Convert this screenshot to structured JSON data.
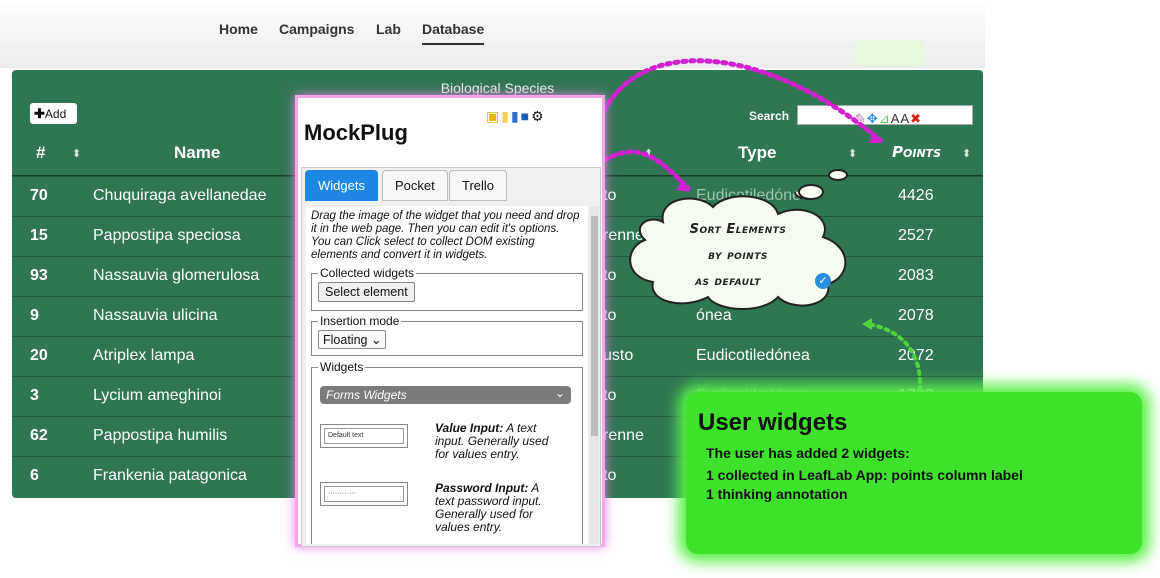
{
  "nav": {
    "items": [
      "Home",
      "Campaigns",
      "Lab",
      "Database"
    ],
    "active": "Database"
  },
  "table": {
    "title": "Biological Species",
    "add_label": "Add",
    "search_label": "Search",
    "headers": {
      "id": "#",
      "name": "Name",
      "type": "Type",
      "points": "Points"
    },
    "rows": [
      {
        "id": "70",
        "name": "Chuquiraga avellanedae",
        "loc": "to",
        "type": "Eudicotiledónea",
        "points": "4426"
      },
      {
        "id": "15",
        "name": "Pappostipa speciosa",
        "loc": "renne",
        "type": "",
        "points": "2527"
      },
      {
        "id": "93",
        "name": "Nassauvia glomerulosa",
        "loc": "to",
        "type": "",
        "points": "2083"
      },
      {
        "id": "9",
        "name": "Nassauvia ulicina",
        "loc": "to",
        "type": "ónea",
        "points": "2078"
      },
      {
        "id": "20",
        "name": "Atriplex lampa",
        "loc": "usto",
        "type": "Eudicotiledónea",
        "points": "2072"
      },
      {
        "id": "3",
        "name": "Lycium ameghinoi",
        "loc": "to",
        "type": "Eudicotiledónea",
        "points": "1732"
      },
      {
        "id": "62",
        "name": "Pappostipa humilis",
        "loc": "renne",
        "type": "",
        "points": ""
      },
      {
        "id": "6",
        "name": "Frankenia patagonica",
        "loc": "to",
        "type": "",
        "points": ""
      }
    ]
  },
  "mockplug": {
    "title": "MockPlug",
    "tabs": [
      "Widgets",
      "Pocket",
      "Trello"
    ],
    "description": "Drag the image of the widget that you need and drop it in the web page. Then you can edit it's options. You can Click select to collect DOM existing elements and convert it in widgets.",
    "collected_legend": "Collected widgets",
    "select_button": "Select element",
    "insertion_legend": "Insertion mode",
    "insertion_value": "Floating",
    "widgets_legend": "Widgets",
    "accordion_label": "Forms Widgets",
    "value_thumb": "Default text",
    "value_input_name": "Value Input:",
    "value_input_desc": "A text input. Generally used for values entry.",
    "password_thumb": "············",
    "password_input_name": "Password Input:",
    "password_input_desc": "A text password input. Generally used for values entry."
  },
  "annotation": {
    "lines": [
      "Sort Elements",
      "by points",
      "as default"
    ]
  },
  "callout": {
    "heading": "User widgets",
    "lines": [
      "The user has added 2 widgets:",
      "1 collected in LeafLab App: points column label",
      "1 thinking annotation"
    ]
  },
  "colors": {
    "table_bg": "#2f7653",
    "tab_active": "#1e87e6",
    "callout": "#3ee22a",
    "arrow": "#d21fd0"
  }
}
